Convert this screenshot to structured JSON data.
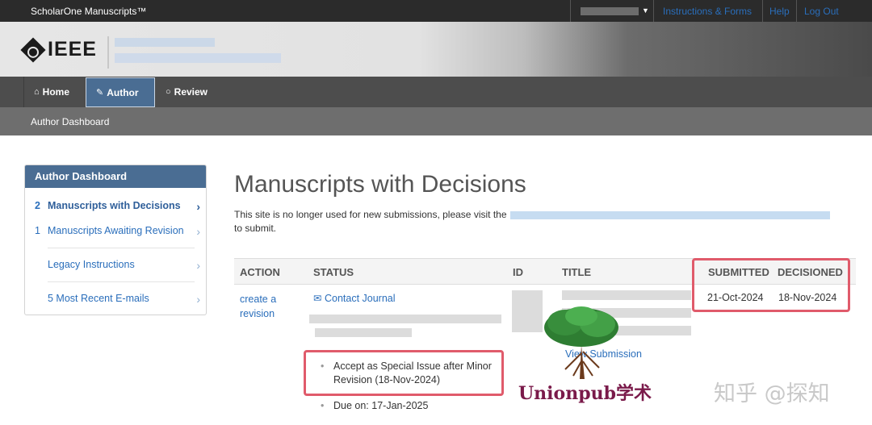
{
  "topbar": {
    "brand": "ScholarOne Manuscripts™",
    "links": [
      "Instructions & Forms",
      "Help",
      "Log Out"
    ]
  },
  "header": {
    "logo_text": "IEEE"
  },
  "nav": {
    "home": "Home",
    "author": "Author",
    "review": "Review"
  },
  "breadcrumb": "Author Dashboard",
  "sidebar": {
    "title": "Author Dashboard",
    "items": [
      {
        "count": "2",
        "label": "Manuscripts with Decisions"
      },
      {
        "count": "1",
        "label": "Manuscripts Awaiting Revision"
      },
      {
        "count": "",
        "label": "Legacy Instructions"
      },
      {
        "count": "",
        "label": "5 Most Recent E-mails"
      }
    ]
  },
  "main": {
    "title": "Manuscripts with Decisions",
    "notice_before": "This site is no longer used for new submissions, please visit the",
    "notice_after": "to submit.",
    "columns": [
      "ACTION",
      "STATUS",
      "ID",
      "TITLE",
      "SUBMITTED",
      "DECISIONED"
    ],
    "row": {
      "action_line1": "create a",
      "action_line2": "revision",
      "contact": "Contact Journal",
      "decision_line1": "Accept as Special Issue after Minor",
      "decision_line2": "Revision (18-Nov-2024)",
      "due": "Due on: 17-Jan-2025",
      "view_submission": "View Submission",
      "submitted": "21-Oct-2024",
      "decisioned": "18-Nov-2024"
    }
  },
  "watermarks": {
    "unionpub": "Unionpub学术",
    "zhihu": "知乎 @探知"
  },
  "colors": {
    "accent": "#4a6d93",
    "link": "#2a6ebb",
    "highlight_box": "#e05b6b"
  }
}
